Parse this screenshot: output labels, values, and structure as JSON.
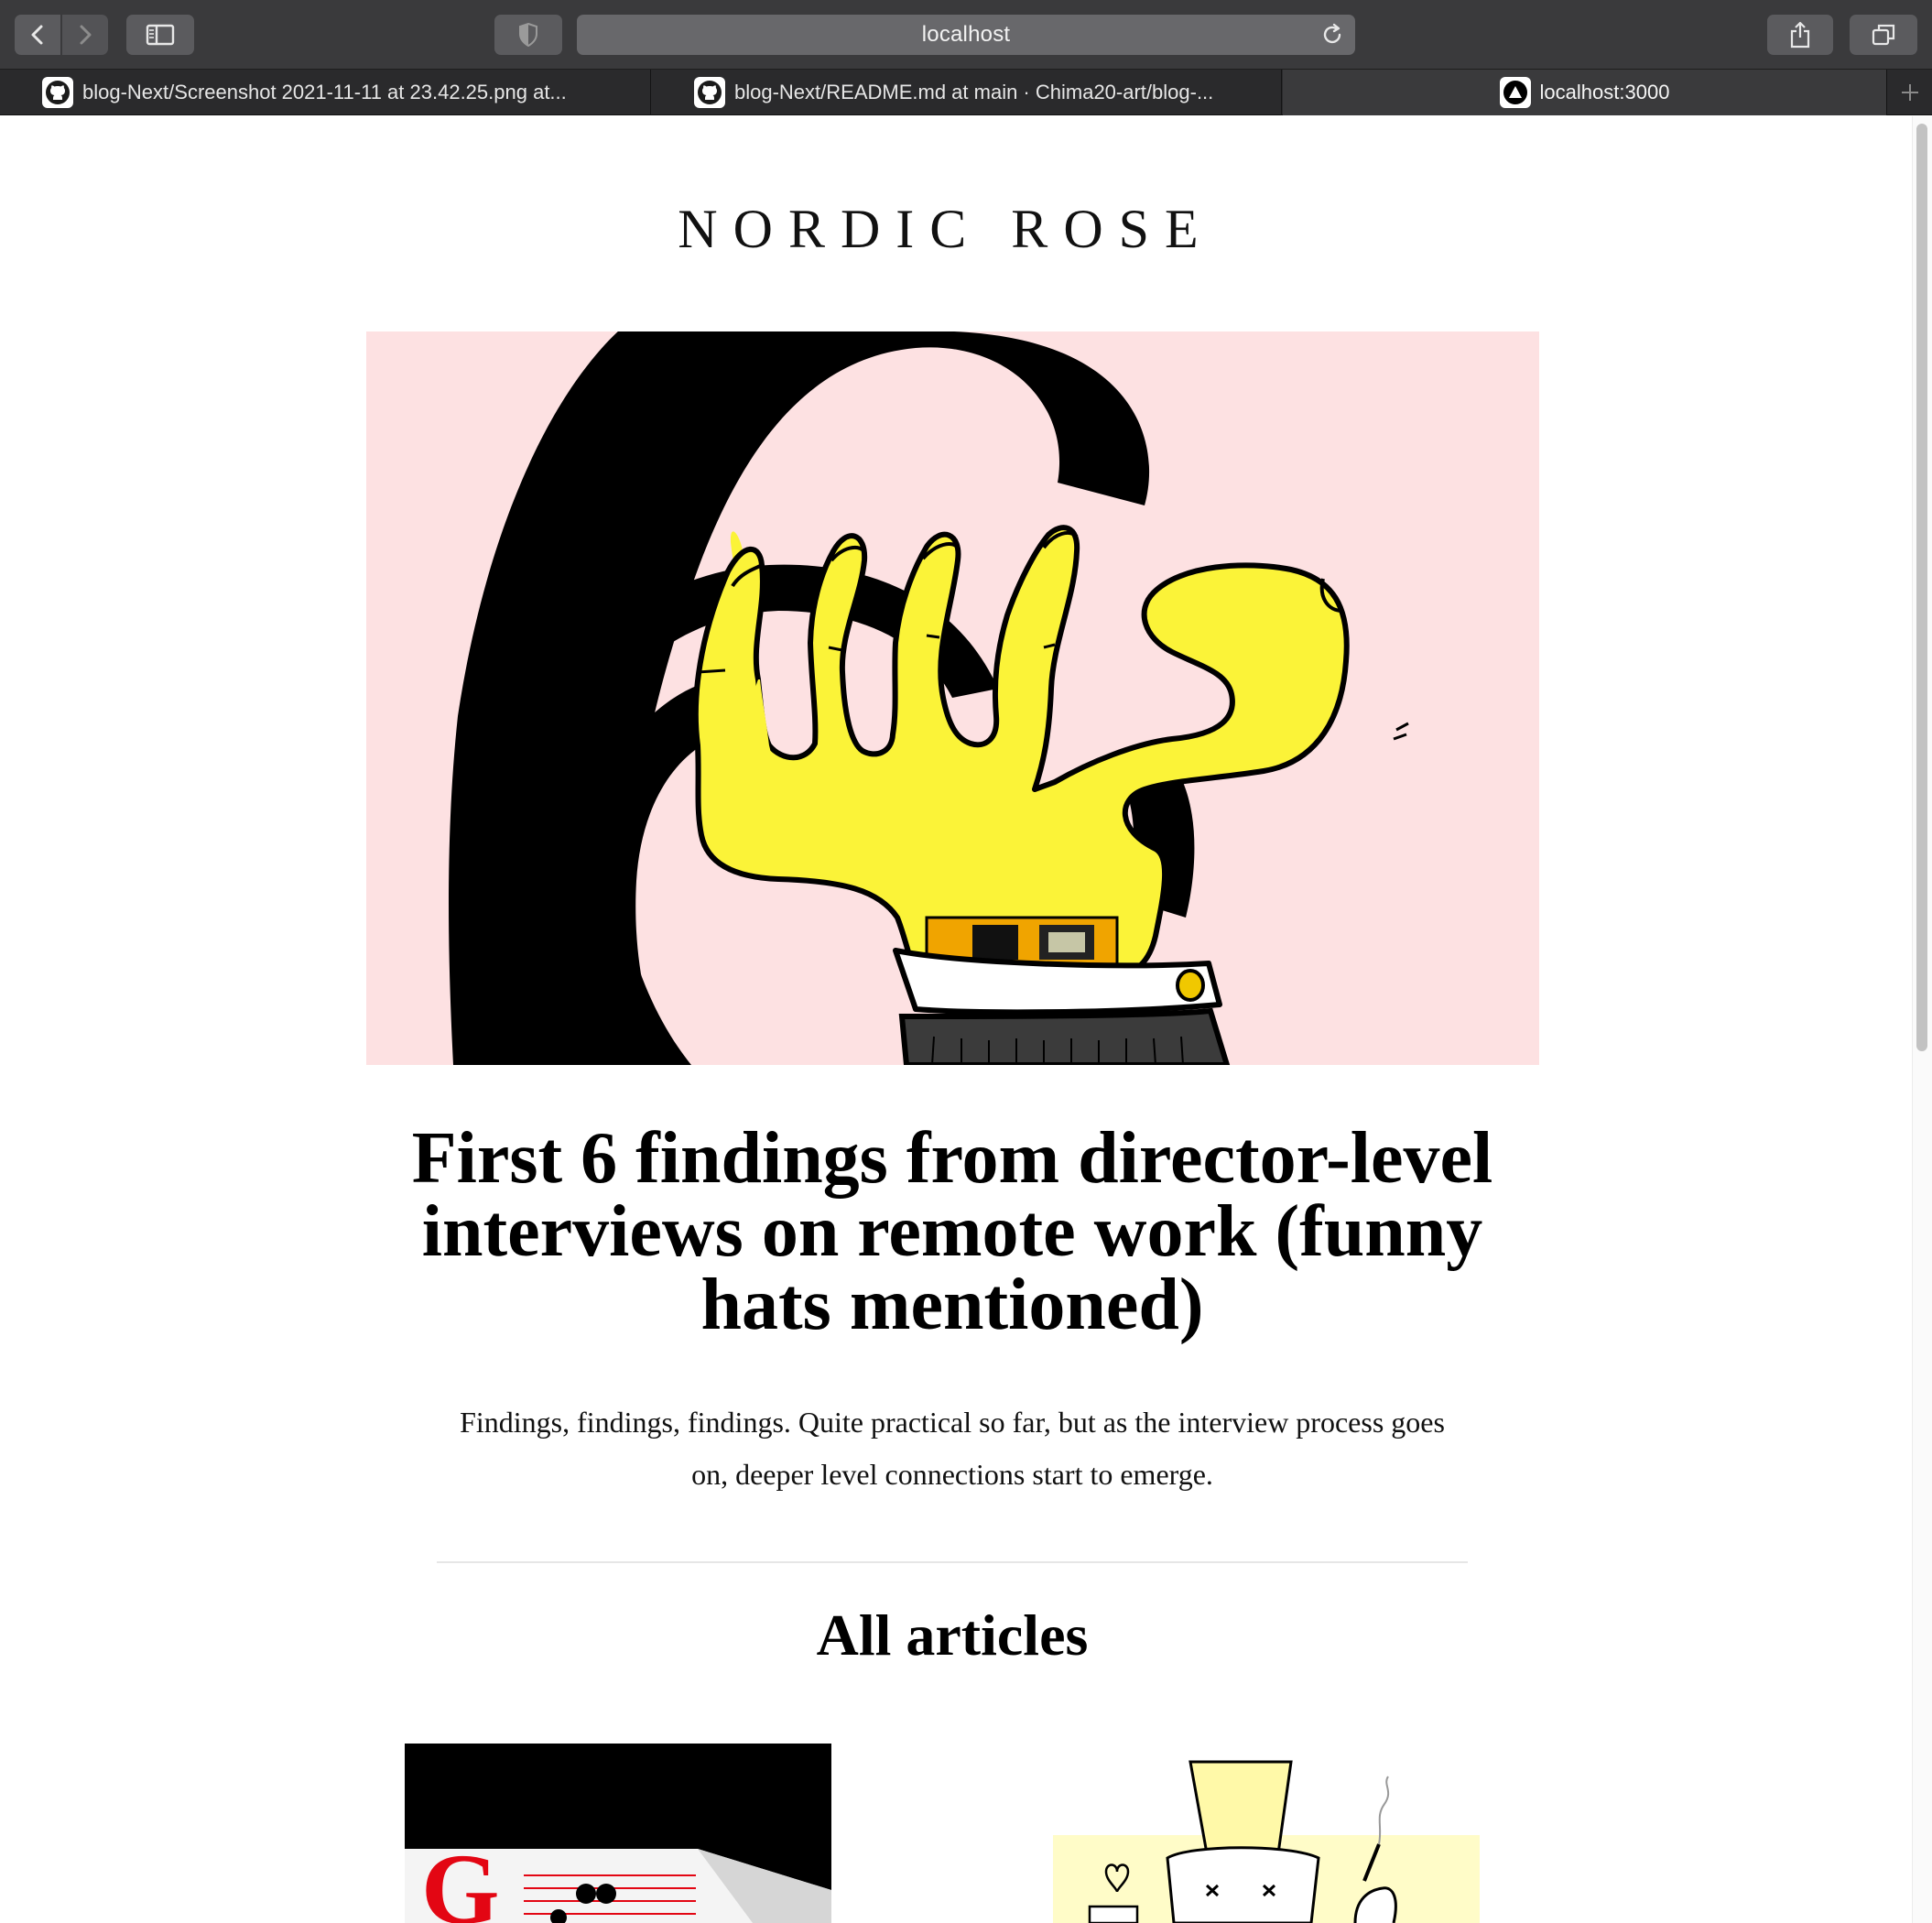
{
  "browser": {
    "address": "localhost",
    "tabs": [
      {
        "label": "blog-Next/Screenshot 2021-11-11 at 23.42.25.png at...",
        "icon": "github-icon"
      },
      {
        "label": "blog-Next/README.md at main · Chima20-art/blog-...",
        "icon": "github-icon"
      },
      {
        "label": "localhost:3000",
        "icon": "triangle-logo-icon",
        "active": true
      }
    ],
    "toolbar_icons": [
      "back-icon",
      "forward-icon",
      "sidebar-icon",
      "shield-icon",
      "reload-icon",
      "share-icon",
      "tabs-overview-icon",
      "new-tab-plus-icon"
    ]
  },
  "page": {
    "site_title": "NORDIC ROSE",
    "hero": {
      "image": "illustration-yellow-hand-with-digital-watch",
      "title": "First 6 findings from director-level interviews on remote work (funny hats mentioned)",
      "excerpt": "Findings, findings, findings. Quite practical so far, but as the interview process goes on, deeper level connections start to emerge."
    },
    "all_articles_heading": "All articles",
    "article_cards": [
      {
        "image": "illustration-red-G-notebook"
      },
      {
        "image": "illustration-open-head-with-light"
      }
    ]
  },
  "colors": {
    "hero_background": "#fde1e2",
    "hand_yellow": "#fbf338",
    "chrome_dark": "#3a3a3c"
  }
}
